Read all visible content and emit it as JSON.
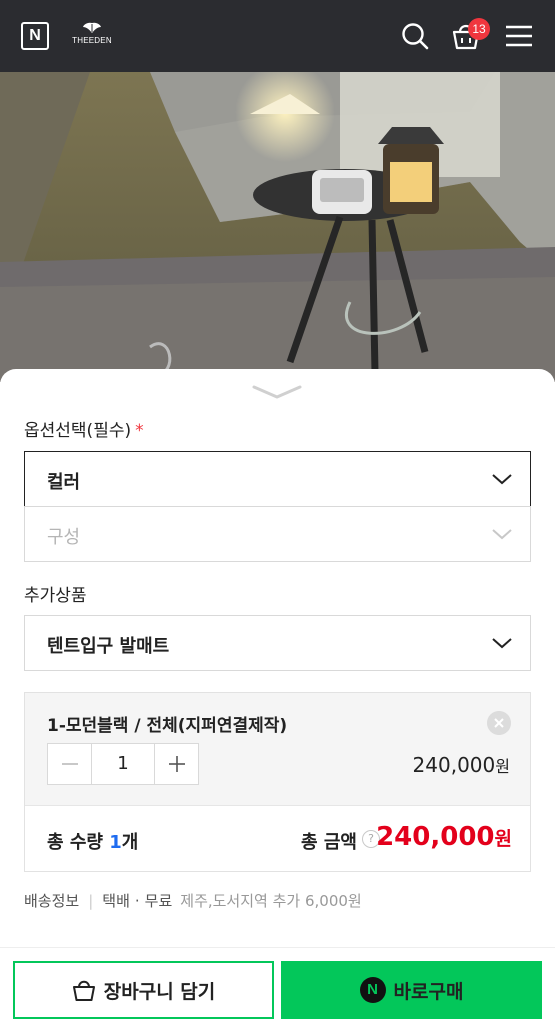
{
  "header": {
    "logo_letter": "N",
    "brand_name": "THEEDEN",
    "cart_count": "13"
  },
  "icons": [
    "n-logo-icon",
    "brand-logo-icon",
    "search-icon",
    "shopping-bag-icon",
    "hamburger-menu-icon",
    "chevron-down-icon",
    "close-icon",
    "minus-icon",
    "plus-icon",
    "question-icon",
    "naver-pay-icon"
  ],
  "colors": {
    "header_bg": "#2b2c30",
    "badge": "#f0363e",
    "price_red": "#e3001b",
    "qty_blue": "#1f6cf0",
    "npay_green": "#03c75a"
  },
  "options": {
    "title": "옵션선택(필수)",
    "required_mark": "*",
    "color_select": "컬러",
    "config_select": "구성"
  },
  "addons": {
    "title": "추가상품",
    "select": "텐트입구 발매트"
  },
  "selected_option": {
    "name": "1-모던블랙 / 전체(지퍼연결제작)",
    "quantity": "1",
    "price": "240,000",
    "currency": "원"
  },
  "totals": {
    "qty_label": "총 수량",
    "qty_value": "1",
    "qty_unit": "개",
    "amount_label": "총 금액",
    "amount_value": "240,000",
    "currency": "원",
    "help_symbol": "?"
  },
  "shipping": {
    "label": "배송정보",
    "method": "택배",
    "fee": "무료",
    "extra": "제주,도서지역 추가 6,000원"
  },
  "actions": {
    "cart_label": "장바구니 담기",
    "buy_label": "바로구매",
    "npay_letter": "N"
  }
}
